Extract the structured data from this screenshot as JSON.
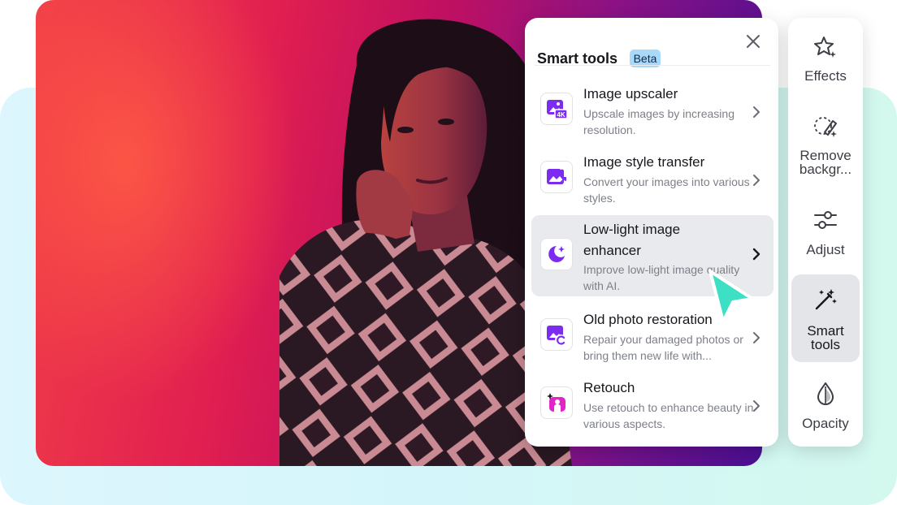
{
  "panel": {
    "title": "Smart tools",
    "badge": "Beta",
    "tools": [
      {
        "name": "Image upscaler",
        "desc": "Upscale images by increasing resolution.",
        "icon": "image-4k-icon"
      },
      {
        "name": "Image style transfer",
        "desc": "Convert your images into various styles.",
        "icon": "image-style-icon"
      },
      {
        "name": "Low-light image enhancer",
        "desc": "Improve low-light image quality with AI.",
        "icon": "moon-sparkle-icon"
      },
      {
        "name": "Old photo restoration",
        "desc": "Repair your damaged photos or bring them new life with...",
        "icon": "photo-restore-icon"
      },
      {
        "name": "Retouch",
        "desc": "Use retouch to enhance beauty in various aspects.",
        "icon": "retouch-icon"
      }
    ]
  },
  "rail": {
    "items": [
      {
        "label": "Effects",
        "icon": "star-outline-icon"
      },
      {
        "label": "Remove backgr...",
        "icon": "eraser-icon"
      },
      {
        "label": "Adjust",
        "icon": "sliders-icon"
      },
      {
        "label": "Smart tools",
        "icon": "magic-wand-icon"
      },
      {
        "label": "Opacity",
        "icon": "drop-icon"
      }
    ]
  },
  "colors": {
    "accent_purple": "#7b2cf0",
    "cursor_teal": "#3de0c4",
    "badge_blue": "#a8d9fb"
  }
}
